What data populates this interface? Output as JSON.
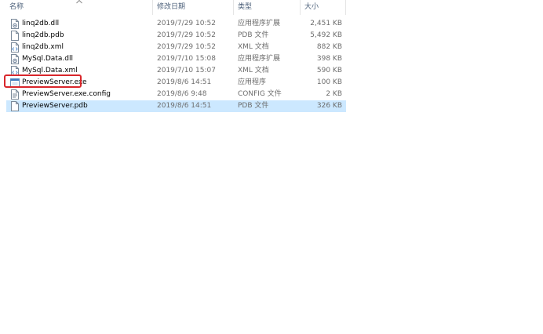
{
  "columns": {
    "name": "名称",
    "date": "修改日期",
    "type": "类型",
    "size": "大小"
  },
  "files": [
    {
      "name": "linq2db.dll",
      "date": "2019/7/29 10:52",
      "type": "应用程序扩展",
      "size": "2,451 KB",
      "icon": "dll-icon"
    },
    {
      "name": "linq2db.pdb",
      "date": "2019/7/29 10:52",
      "type": "PDB 文件",
      "size": "5,492 KB",
      "icon": "file-icon"
    },
    {
      "name": "linq2db.xml",
      "date": "2019/7/29 10:52",
      "type": "XML 文档",
      "size": "882 KB",
      "icon": "xml-icon"
    },
    {
      "name": "MySql.Data.dll",
      "date": "2019/7/10 15:08",
      "type": "应用程序扩展",
      "size": "398 KB",
      "icon": "dll-icon"
    },
    {
      "name": "MySql.Data.xml",
      "date": "2019/7/10 15:07",
      "type": "XML 文档",
      "size": "590 KB",
      "icon": "xml-icon"
    },
    {
      "name": "PreviewServer.exe",
      "date": "2019/8/6 14:51",
      "type": "应用程序",
      "size": "100 KB",
      "icon": "exe-icon"
    },
    {
      "name": "PreviewServer.exe.config",
      "date": "2019/8/6 9:48",
      "type": "CONFIG 文件",
      "size": "2 KB",
      "icon": "config-icon"
    },
    {
      "name": "PreviewServer.pdb",
      "date": "2019/8/6 14:51",
      "type": "PDB 文件",
      "size": "326 KB",
      "icon": "file-icon"
    }
  ],
  "selected_index": 7,
  "highlighted_index": 5,
  "colors": {
    "selection": "#cce8ff",
    "highlight_border": "#d9262b",
    "header_text": "#4c607a",
    "meta_text": "#6d6d6d"
  }
}
